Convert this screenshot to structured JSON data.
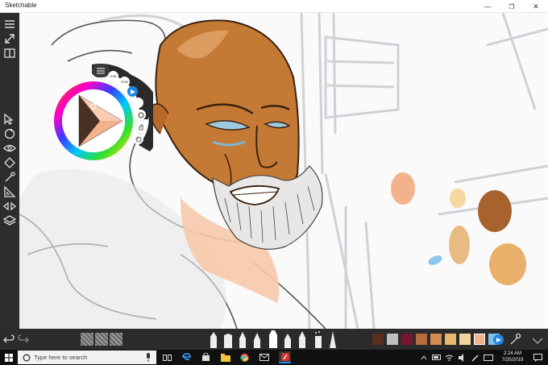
{
  "window": {
    "title": "Sketchable",
    "minimize_icon": "minimize-icon",
    "maximize_icon": "maximize-icon",
    "close_icon": "close-icon"
  },
  "left_toolbar": {
    "tools": [
      "menu-icon",
      "expand-icon",
      "book-icon",
      "select-icon",
      "lasso-icon",
      "eye-icon",
      "fill-icon",
      "eyedropper-icon",
      "ruler-icon",
      "mirror-icon",
      "layers-icon"
    ]
  },
  "color_panel": {
    "mode_labels": [
      "HSB",
      "RGB"
    ],
    "current_color": "#f4b08a"
  },
  "bottom_toolbar": {
    "undo_icon": "undo-icon",
    "redo_icon": "redo-icon",
    "palette": [
      "#5a2e1f",
      "#bfbfbf",
      "#7a1530",
      "#b86b3b",
      "#d28a52",
      "#e8b86a",
      "#f3d49e",
      "#f4b08a",
      "#7fc0e6"
    ],
    "brushes": [
      "pencil",
      "marker",
      "pen",
      "brush",
      "highlighter",
      "ink",
      "calligraphy",
      "spray",
      "smudge"
    ]
  },
  "taskbar": {
    "search_placeholder": "Type here to search",
    "time": "2:24 AM",
    "date": "7/20/2019",
    "apps": [
      "task-view-icon",
      "edge-icon",
      "store-icon",
      "file-explorer-icon",
      "chrome-icon",
      "mail-icon",
      "sketchable-icon"
    ]
  },
  "colors": {
    "toolbar_bg": "#2d2d2d",
    "accent": "#1e88e5",
    "skin": "#c77b3a"
  }
}
